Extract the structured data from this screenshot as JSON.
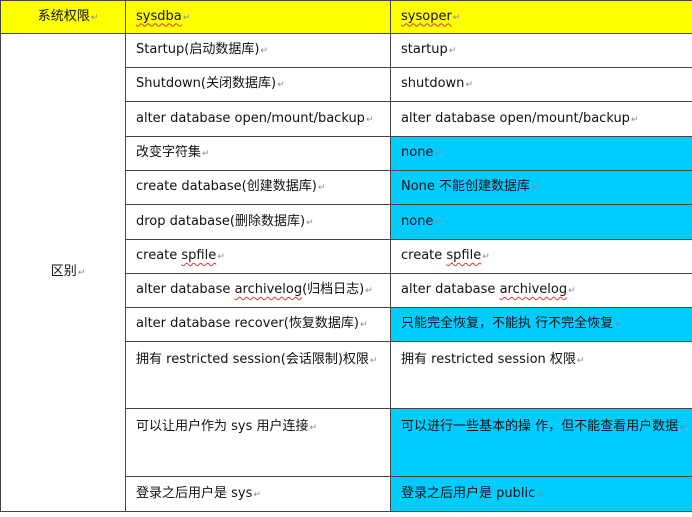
{
  "table": {
    "headers": [
      "系统权限",
      "sysdba",
      "sysoper"
    ],
    "category": "区别",
    "para_mark": "↵",
    "rows": [
      {
        "sysdba": "Startup(启动数据库)",
        "sysoper": "startup",
        "highlight": false
      },
      {
        "sysdba": "Shutdown(关闭数据库)",
        "sysoper": "shutdown",
        "highlight": false
      },
      {
        "sysdba": "alter database  open/mount/backup",
        "sysoper": "alter database  open/mount/backup",
        "highlight": false
      },
      {
        "sysdba": "改变字符集",
        "sysoper": "none",
        "highlight": true
      },
      {
        "sysdba": "create database(创建数据库)",
        "sysoper": "None 不能创建数据库",
        "highlight": true
      },
      {
        "sysdba": "drop database(删除数据库)",
        "sysoper": "none",
        "highlight": true
      },
      {
        "sysdba_pre": "create ",
        "sysdba_sq": "spfile",
        "sysoper_pre": "create ",
        "sysoper_sq": "spfile",
        "highlight": false
      },
      {
        "sysdba_pre": "alter database  ",
        "sysdba_sq": "archivelog",
        "sysdba_post": "(归档日志)",
        "sysoper_pre": "alter database  ",
        "sysoper_sq": "archivelog",
        "highlight": false
      },
      {
        "sysdba": "alter database  recover(恢复数据库)",
        "sysoper": "只能完全恢复，不能执 行不完全恢复",
        "highlight": true
      },
      {
        "sysdba": "拥有 restricted session(会话限制)权限",
        "sysoper": "拥有 restricted session 权限",
        "highlight": false
      },
      {
        "sysdba": "可以让用户作为 sys 用户连接",
        "sysoper": "可以进行一些基本的操 作，但不能查看用户数据",
        "highlight": true
      },
      {
        "sysdba": "登录之后用户是 sys",
        "sysoper": "登录之后用户是 public",
        "highlight": true
      }
    ]
  },
  "colors": {
    "header_bg": "#ffff00",
    "highlight_bg": "#00ccff",
    "border": "#444444"
  }
}
